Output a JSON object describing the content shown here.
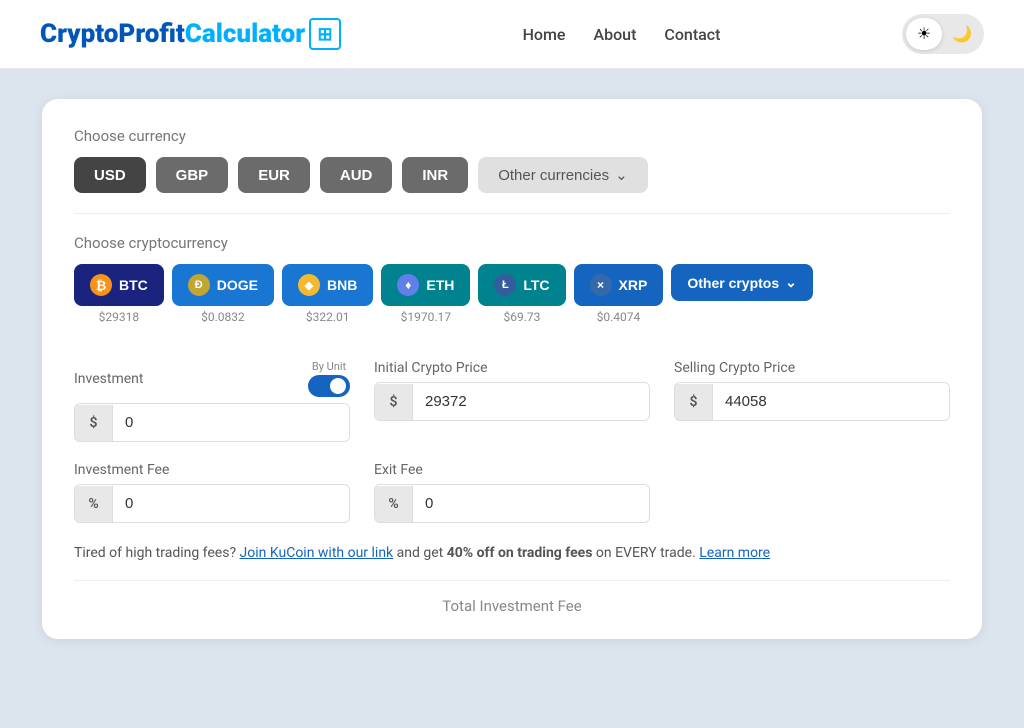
{
  "header": {
    "logo": {
      "crypto": "Crypto",
      "profit": "Profit",
      "calculator": "Calculator",
      "icon": "⊞"
    },
    "nav": {
      "home": "Home",
      "about": "About",
      "contact": "Contact"
    },
    "theme": {
      "light_icon": "☀",
      "dark_icon": "🌙"
    }
  },
  "currency_section": {
    "label": "Choose currency",
    "buttons": [
      {
        "id": "usd",
        "label": "USD",
        "active": true
      },
      {
        "id": "gbp",
        "label": "GBP",
        "active": false
      },
      {
        "id": "eur",
        "label": "EUR",
        "active": false
      },
      {
        "id": "aud",
        "label": "AUD",
        "active": false
      },
      {
        "id": "inr",
        "label": "INR",
        "active": false
      }
    ],
    "other_label": "Other currencies",
    "other_icon": "⌄"
  },
  "crypto_section": {
    "label": "Choose cryptocurrency",
    "buttons": [
      {
        "id": "btc",
        "label": "BTC",
        "icon": "₿",
        "price": "$29318",
        "active": true
      },
      {
        "id": "doge",
        "label": "DOGE",
        "icon": "Ð",
        "price": "$0.0832",
        "active": false
      },
      {
        "id": "bnb",
        "label": "BNB",
        "icon": "◆",
        "price": "$322.01",
        "active": false
      },
      {
        "id": "eth",
        "label": "ETH",
        "icon": "♦",
        "price": "$1970.17",
        "active": false
      },
      {
        "id": "ltc",
        "label": "LTC",
        "icon": "Ł",
        "price": "$69.73",
        "active": false
      },
      {
        "id": "xrp",
        "label": "XRP",
        "icon": "×",
        "price": "$0.4074",
        "active": false
      }
    ],
    "other_label": "Other cryptos",
    "other_icon": "⌄"
  },
  "form": {
    "investment": {
      "label": "Investment",
      "toggle_label": "By Unit",
      "prefix": "$",
      "value": "0",
      "placeholder": "0"
    },
    "initial_price": {
      "label": "Initial Crypto Price",
      "prefix": "$",
      "value": "29372",
      "placeholder": "29372"
    },
    "selling_price": {
      "label": "Selling Crypto Price",
      "prefix": "$",
      "value": "44058",
      "placeholder": "44058"
    },
    "investment_fee": {
      "label": "Investment Fee",
      "prefix": "%",
      "value": "0",
      "placeholder": "0"
    },
    "exit_fee": {
      "label": "Exit Fee",
      "prefix": "%",
      "value": "0",
      "placeholder": "0"
    }
  },
  "promo": {
    "text_before": "Tired of high trading fees? ",
    "link1_text": "Join KuCoin with our link",
    "text_middle": " and get ",
    "bold_text": "40% off on trading fees",
    "text_after": " on EVERY trade. ",
    "link2_text": "Learn more"
  },
  "total": {
    "label": "Total Investment Fee"
  }
}
